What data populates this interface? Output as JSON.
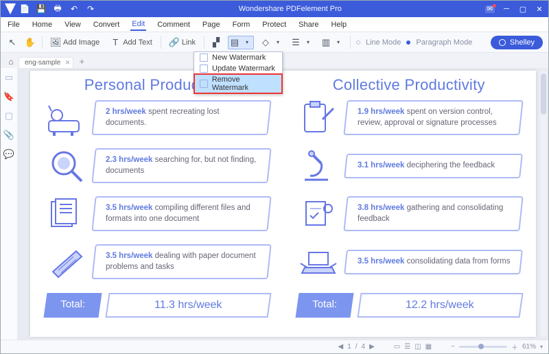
{
  "titlebar": {
    "title": "Wondershare PDFelement Pro"
  },
  "menus": [
    "File",
    "Home",
    "View",
    "Convert",
    "Edit",
    "Comment",
    "Page",
    "Form",
    "Protect",
    "Share",
    "Help"
  ],
  "active_menu": "Edit",
  "toolbar": {
    "add_image": "Add Image",
    "add_text": "Add Text",
    "link": "Link",
    "line_mode": "Line Mode",
    "paragraph_mode": "Paragraph Mode"
  },
  "user": {
    "name": "Shelley"
  },
  "tab": {
    "filename": "eng-sample"
  },
  "dropdown": {
    "items": [
      "New Watermark",
      "Update Watermark",
      "Remove Watermark"
    ],
    "selected_index": 2
  },
  "doc": {
    "left": {
      "heading": "Personal Productivity",
      "rows": [
        {
          "bold": "2 hrs/week",
          "text": " spent recreating lost documents."
        },
        {
          "bold": "2.3 hrs/week",
          "text": " searching for, but not finding, documents"
        },
        {
          "bold": "3.5 hrs/week",
          "text": " compiling different files and formats into one document"
        },
        {
          "bold": "3.5 hrs/week",
          "text": " dealing with paper document problems and tasks"
        }
      ],
      "total_label": "Total:",
      "total_value": "11.3 hrs/week"
    },
    "right": {
      "heading": "Collective Productivity",
      "rows": [
        {
          "bold": "1.9 hrs/week",
          "text": "  spent on version control, review, approval or signature processes"
        },
        {
          "bold": "3.1 hrs/week",
          "text": " deciphering the feedback"
        },
        {
          "bold": "3.8 hrs/week",
          "text": " gathering and consolidating feedback"
        },
        {
          "bold": "3.5 hrs/week",
          "text": " consolidating data from forms"
        }
      ],
      "total_label": "Total:",
      "total_value": "12.2 hrs/week"
    }
  },
  "status": {
    "page_current": "1",
    "page_total": "4",
    "zoom": "61%"
  }
}
